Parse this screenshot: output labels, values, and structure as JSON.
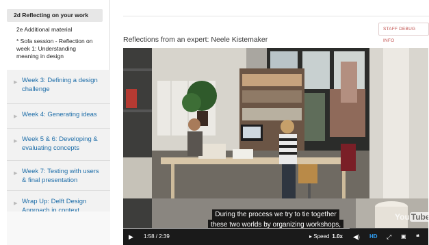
{
  "sidebar": {
    "sub_items": [
      "2d Reflecting on your work",
      "2e Additional material",
      "* Sofa session - Reflection on week 1: Understanding meaning in design"
    ],
    "weeks": [
      "Week 3: Defining a design challenge",
      "Week 4: Generating ideas",
      "Week 5 & 6: Developing & evaluating concepts",
      "Week 7: Testing with users & final presentation",
      "Wrap Up: Delft Design Approach in context"
    ]
  },
  "main": {
    "debug_label": "STAFF DEBUG INFO",
    "video_title": "Reflections from an expert: Neele Kistemaker"
  },
  "video": {
    "caption_line1": "During the process we try to tie together",
    "caption_line2": "these two worlds by organizing workshops,",
    "logo_you": "You",
    "logo_tube": "Tube",
    "time": "1:58 / 2:39",
    "speed_label": "Speed",
    "speed_value": "1.0x",
    "hd_label": "HD",
    "progress": 0.742,
    "colors": {
      "controls_bg": "#1a1a1a",
      "hd": "#2f9cf0",
      "link": "#1b6ca8",
      "debug": "#c0504d"
    }
  }
}
